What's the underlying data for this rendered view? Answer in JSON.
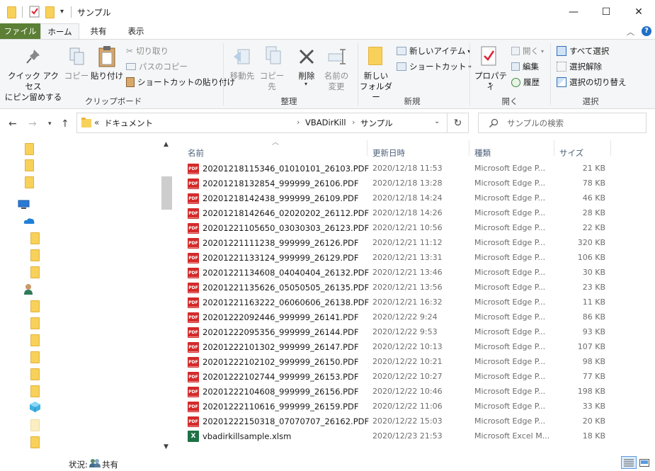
{
  "window": {
    "title": "サンプル",
    "minimize_glyph": "—",
    "maximize_glyph": "☐",
    "close_glyph": "✕"
  },
  "tabs": [
    {
      "label": "ファイル"
    },
    {
      "label": "ホーム"
    },
    {
      "label": "共有"
    },
    {
      "label": "表示"
    }
  ],
  "ribbon": {
    "clipboard": {
      "label": "クリップボード",
      "pin_quick_access_1": "クイック アクセス",
      "pin_quick_access_2": "にピン留めする",
      "copy": "コピー",
      "paste": "貼り付け",
      "cut": "切り取り",
      "copy_path": "パスのコピー",
      "paste_shortcut": "ショートカットの貼り付け"
    },
    "organize": {
      "label": "整理",
      "move_to": "移動先",
      "copy_to": "コピー先",
      "delete": "削除",
      "rename_1": "名前の",
      "rename_2": "変更"
    },
    "new": {
      "label": "新規",
      "new_folder_1": "新しい",
      "new_folder_2": "フォルダー",
      "new_item": "新しいアイテム",
      "easy_access": "ショートカット"
    },
    "open": {
      "label": "開く",
      "properties": "プロパティ",
      "open": "開く",
      "edit": "編集",
      "history": "履歴"
    },
    "select": {
      "label": "選択",
      "select_all": "すべて選択",
      "select_none": "選択解除",
      "invert": "選択の切り替え"
    }
  },
  "address": {
    "overflow": "«",
    "crumbs": [
      "ドキュメント",
      "VBADirKill",
      "サンプル"
    ],
    "search_placeholder": "サンプルの検索"
  },
  "columns": {
    "name": "名前",
    "date": "更新日時",
    "type": "種類",
    "size": "サイズ"
  },
  "files": [
    {
      "name": "20201218115346_01010101_26103.PDF",
      "date": "2020/12/18 11:53",
      "type": "Microsoft Edge P...",
      "size": "21 KB",
      "kind": "pdf"
    },
    {
      "name": "20201218132854_999999_26106.PDF",
      "date": "2020/12/18 13:28",
      "type": "Microsoft Edge P...",
      "size": "78 KB",
      "kind": "pdf"
    },
    {
      "name": "20201218142438_999999_26109.PDF",
      "date": "2020/12/18 14:24",
      "type": "Microsoft Edge P...",
      "size": "46 KB",
      "kind": "pdf"
    },
    {
      "name": "20201218142646_02020202_26112.PDF",
      "date": "2020/12/18 14:26",
      "type": "Microsoft Edge P...",
      "size": "28 KB",
      "kind": "pdf"
    },
    {
      "name": "20201221105650_03030303_26123.PDF",
      "date": "2020/12/21 10:56",
      "type": "Microsoft Edge P...",
      "size": "22 KB",
      "kind": "pdf"
    },
    {
      "name": "20201221111238_999999_26126.PDF",
      "date": "2020/12/21 11:12",
      "type": "Microsoft Edge P...",
      "size": "320 KB",
      "kind": "pdf"
    },
    {
      "name": "20201221133124_999999_26129.PDF",
      "date": "2020/12/21 13:31",
      "type": "Microsoft Edge P...",
      "size": "106 KB",
      "kind": "pdf"
    },
    {
      "name": "20201221134608_04040404_26132.PDF",
      "date": "2020/12/21 13:46",
      "type": "Microsoft Edge P...",
      "size": "30 KB",
      "kind": "pdf"
    },
    {
      "name": "20201221135626_05050505_26135.PDF",
      "date": "2020/12/21 13:56",
      "type": "Microsoft Edge P...",
      "size": "23 KB",
      "kind": "pdf"
    },
    {
      "name": "20201221163222_06060606_26138.PDF",
      "date": "2020/12/21 16:32",
      "type": "Microsoft Edge P...",
      "size": "11 KB",
      "kind": "pdf"
    },
    {
      "name": "20201222092446_999999_26141.PDF",
      "date": "2020/12/22 9:24",
      "type": "Microsoft Edge P...",
      "size": "86 KB",
      "kind": "pdf"
    },
    {
      "name": "20201222095356_999999_26144.PDF",
      "date": "2020/12/22 9:53",
      "type": "Microsoft Edge P...",
      "size": "93 KB",
      "kind": "pdf"
    },
    {
      "name": "20201222101302_999999_26147.PDF",
      "date": "2020/12/22 10:13",
      "type": "Microsoft Edge P...",
      "size": "107 KB",
      "kind": "pdf"
    },
    {
      "name": "20201222102102_999999_26150.PDF",
      "date": "2020/12/22 10:21",
      "type": "Microsoft Edge P...",
      "size": "98 KB",
      "kind": "pdf"
    },
    {
      "name": "20201222102744_999999_26153.PDF",
      "date": "2020/12/22 10:27",
      "type": "Microsoft Edge P...",
      "size": "77 KB",
      "kind": "pdf"
    },
    {
      "name": "20201222104608_999999_26156.PDF",
      "date": "2020/12/22 10:46",
      "type": "Microsoft Edge P...",
      "size": "198 KB",
      "kind": "pdf"
    },
    {
      "name": "20201222110616_999999_26159.PDF",
      "date": "2020/12/22 11:06",
      "type": "Microsoft Edge P...",
      "size": "33 KB",
      "kind": "pdf"
    },
    {
      "name": "20201222150318_07070707_26162.PDF",
      "date": "2020/12/22 15:03",
      "type": "Microsoft Edge P...",
      "size": "20 KB",
      "kind": "pdf"
    },
    {
      "name": "vbadirkillsample.xlsm",
      "date": "2020/12/23 21:53",
      "type": "Microsoft Excel M...",
      "size": "18 KB",
      "kind": "xlsm"
    }
  ],
  "status": {
    "label": "状況:",
    "value": "共有"
  },
  "icons": {
    "pdf_label": "PDF",
    "xls_label": "X"
  },
  "colors": {
    "file_tab": "#5b7f34",
    "pdf_red": "#d32a2a",
    "excel_green": "#1e7145",
    "folder_yellow": "#f8d15a",
    "accent_blue": "#1f6fc5"
  }
}
